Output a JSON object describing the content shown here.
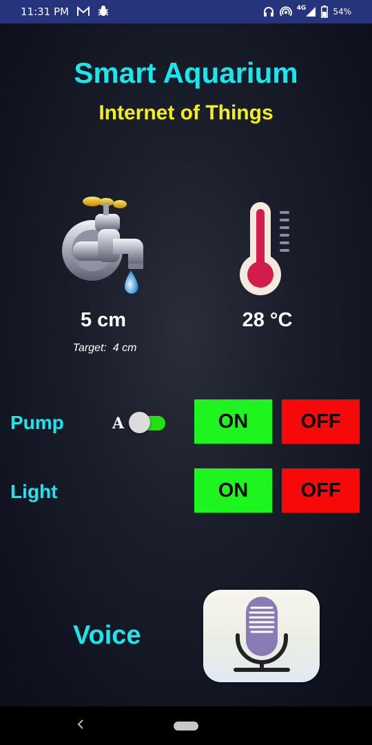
{
  "status_bar": {
    "time": "11:31 PM",
    "network": "4G",
    "battery": "54%",
    "icons": [
      "gmail-icon",
      "bug-icon",
      "headset-icon",
      "hotspot-icon",
      "signal-icon",
      "battery-icon"
    ]
  },
  "header": {
    "title": "Smart Aquarium",
    "subtitle": "Internet of Things"
  },
  "sensors": {
    "water_level": {
      "icon": "water-tap-icon",
      "value": "5 cm",
      "target_label": "Target:",
      "target_value": "4 cm"
    },
    "temperature": {
      "icon": "thermometer-icon",
      "value": "28 °C"
    }
  },
  "controls": {
    "pump": {
      "label": "Pump",
      "auto_label": "A",
      "auto_on": true,
      "on_label": "ON",
      "off_label": "OFF"
    },
    "light": {
      "label": "Light",
      "on_label": "ON",
      "off_label": "OFF"
    }
  },
  "voice": {
    "label": "Voice",
    "icon": "microphone-icon"
  },
  "colors": {
    "status_bar": "#26347d",
    "title": "#17e8ef",
    "subtitle": "#f4f016",
    "on_button": "#1ef51e",
    "off_button": "#f70909",
    "toggle_track": "#22e014"
  }
}
